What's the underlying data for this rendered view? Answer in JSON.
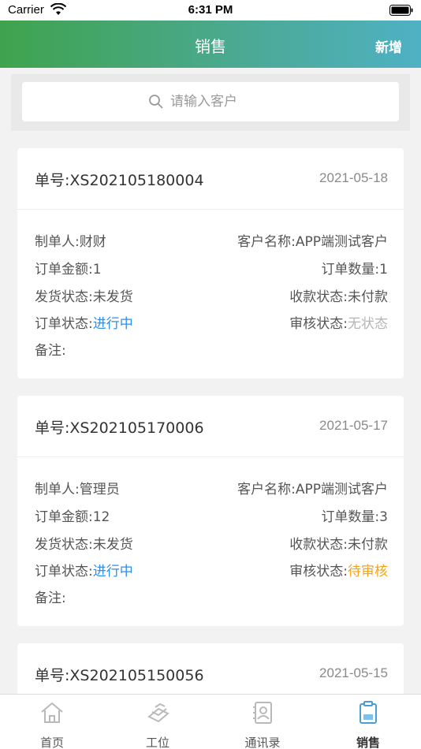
{
  "status_bar": {
    "carrier": "Carrier",
    "time": "6:31 PM"
  },
  "nav": {
    "title": "销售",
    "add_label": "新增"
  },
  "search": {
    "placeholder": "请输入客户"
  },
  "orders": [
    {
      "order_no": "单号:XS202105180004",
      "date": "2021-05-18",
      "maker_label": "制单人:",
      "maker": "财财",
      "customer_label": "客户名称:",
      "customer": "APP端测试客户",
      "amount_label": "订单金额:",
      "amount": "1",
      "qty_label": "订单数量:",
      "qty": "1",
      "ship_label": "发货状态:",
      "ship": "未发货",
      "pay_label": "收款状态:",
      "pay": "未付款",
      "status_label": "订单状态:",
      "status": "进行中",
      "audit_label": "审核状态:",
      "audit": "无状态",
      "remark_label": "备注:"
    },
    {
      "order_no": "单号:XS202105170006",
      "date": "2021-05-17",
      "maker_label": "制单人:",
      "maker": "管理员",
      "customer_label": "客户名称:",
      "customer": "APP端测试客户",
      "amount_label": "订单金额:",
      "amount": "12",
      "qty_label": "订单数量:",
      "qty": "3",
      "ship_label": "发货状态:",
      "ship": "未发货",
      "pay_label": "收款状态:",
      "pay": "未付款",
      "status_label": "订单状态:",
      "status": "进行中",
      "audit_label": "审核状态:",
      "audit": "待审核",
      "remark_label": "备注:"
    },
    {
      "order_no": "单号:XS202105150056",
      "date": "2021-05-15"
    }
  ],
  "tabs": [
    {
      "label": "首页",
      "icon": "home-icon"
    },
    {
      "label": "工位",
      "icon": "workstation-icon"
    },
    {
      "label": "通讯录",
      "icon": "contacts-icon"
    },
    {
      "label": "销售",
      "icon": "sales-icon",
      "active": true
    }
  ],
  "colors": {
    "accent_blue": "#2a8ff0",
    "pending_orange": "#f2a41c",
    "nav_start": "#3fa34d",
    "nav_end": "#4fb1c4"
  }
}
